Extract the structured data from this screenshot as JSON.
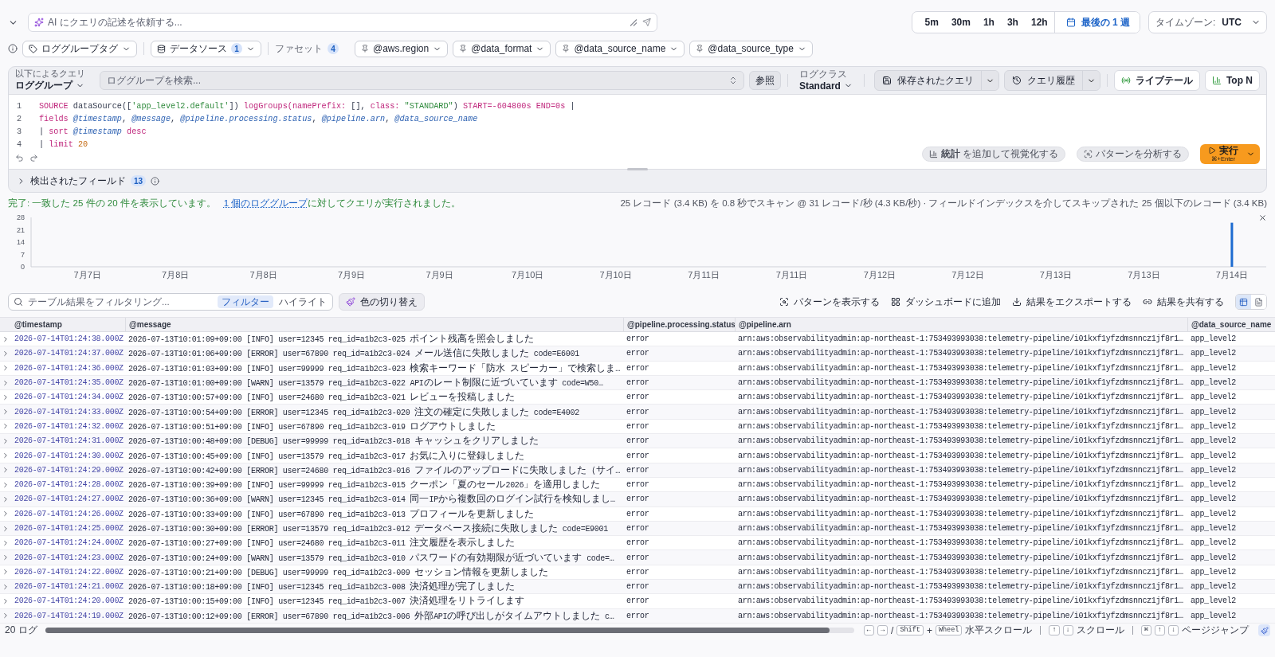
{
  "ai_prompt": {
    "placeholder": "AI にクエリの記述を依頼する..."
  },
  "time_ranges": [
    {
      "label": "5m",
      "selected": false
    },
    {
      "label": "30m",
      "selected": false
    },
    {
      "label": "1h",
      "selected": false
    },
    {
      "label": "3h",
      "selected": false
    },
    {
      "label": "12h",
      "selected": false
    }
  ],
  "custom_range": {
    "label": "最後の 1 週",
    "selected": true
  },
  "timezone": {
    "label": "タイムゾーン:",
    "value": "UTC"
  },
  "filters": {
    "log_group_tags": "ロググループタグ",
    "data_source": {
      "label": "データソース",
      "count": "1"
    },
    "facets": {
      "label": "ファセット",
      "count": "4",
      "items": [
        "@aws.region",
        "@data_format",
        "@data_source_name",
        "@data_source_type"
      ]
    }
  },
  "query": {
    "query_by": {
      "label": "以下によるクエリ",
      "value": "ロググループ"
    },
    "search": {
      "placeholder": "ロググループを検索..."
    },
    "browse": "参照",
    "log_class": {
      "label": "ログクラス",
      "value": "Standard"
    },
    "saved_queries": "保存されたクエリ",
    "history": "クエリ履歴",
    "live_tail": "ライブテール",
    "top_n": "Top N",
    "editor": {
      "lines": [
        {
          "number": "1",
          "tokens": [
            {
              "kind": "keyword",
              "text": "SOURCE"
            },
            {
              "kind": "plain",
              "text": " dataSource(["
            },
            {
              "kind": "string",
              "text": "'app_level2.default'"
            },
            {
              "kind": "plain",
              "text": "]) "
            },
            {
              "kind": "keyword",
              "text": "logGroups(namePrefix:"
            },
            {
              "kind": "plain",
              "text": " [], "
            },
            {
              "kind": "keyword",
              "text": "class: "
            },
            {
              "kind": "string",
              "text": "\"STANDARD\""
            },
            {
              "kind": "plain",
              "text": ") "
            },
            {
              "kind": "keyword",
              "text": "START=-604800s END=0s"
            },
            {
              "kind": "plain",
              "text": " |"
            }
          ]
        },
        {
          "number": "2",
          "tokens": [
            {
              "kind": "keyword",
              "text": "fields "
            },
            {
              "kind": "field",
              "text": "@timestamp"
            },
            {
              "kind": "plain",
              "text": ", "
            },
            {
              "kind": "field",
              "text": "@message"
            },
            {
              "kind": "plain",
              "text": ", "
            },
            {
              "kind": "field",
              "text": "@pipeline.processing.status"
            },
            {
              "kind": "plain",
              "text": ", "
            },
            {
              "kind": "field",
              "text": "@pipeline.arn"
            },
            {
              "kind": "plain",
              "text": ", "
            },
            {
              "kind": "field",
              "text": "@data_source_name"
            }
          ]
        },
        {
          "number": "3",
          "tokens": [
            {
              "kind": "plain",
              "text": "| "
            },
            {
              "kind": "keyword",
              "text": "sort "
            },
            {
              "kind": "field",
              "text": "@timestamp"
            },
            {
              "kind": "keyword",
              "text": " desc"
            }
          ]
        },
        {
          "number": "4",
          "tokens": [
            {
              "kind": "plain",
              "text": "| "
            },
            {
              "kind": "keyword",
              "text": "limit "
            },
            {
              "kind": "number",
              "text": "20"
            }
          ]
        }
      ]
    },
    "actions": {
      "visualize": "**統計** を追加して視覚化する",
      "analyze": "パターンを分析する",
      "run": {
        "label": "実行",
        "shortcut": "⌘+Enter"
      }
    },
    "discovered_fields": {
      "label": "検出されたフィールド",
      "count": "13",
      "expanded": false
    }
  },
  "status": {
    "summary": "完了: 一致した 25 件の 20 件を表示しています。",
    "link": "1 個のロググループ",
    "rest": "に対してクエリが実行されました。",
    "stats": "25 レコード (3.4 KB) を 0.8 秒でスキャン @ 31 レコード/秒 (4.3 KB/秒) · フィールドインデックスを介してスキップされた 25 個以下のレコード (3.4 KB)"
  },
  "histogram": {
    "chart_data": {
      "type": "bar",
      "categories": [
        "7月7日",
        "7月8日",
        "7月8日",
        "7月9日",
        "7月9日",
        "7月10日",
        "7月10日",
        "7月11日",
        "7月11日",
        "7月12日",
        "7月12日",
        "7月13日",
        "7月13日",
        "7月14日"
      ],
      "values": [
        0,
        0,
        0,
        0,
        0,
        0,
        0,
        0,
        0,
        0,
        0,
        0,
        0,
        25
      ],
      "ylim": [
        0,
        28
      ],
      "yticks": [
        0,
        7,
        14,
        21,
        28
      ]
    }
  },
  "table_toolbar": {
    "filter": {
      "placeholder": "テーブル結果をフィルタリング...",
      "modes": [
        {
          "label": "フィルター",
          "selected": true
        },
        {
          "label": "ハイライト",
          "selected": false
        }
      ]
    },
    "color_toggle": "色の切り替え",
    "actions": [
      {
        "kind": "patterns",
        "label": "パターンを表示する"
      },
      {
        "kind": "dashboard",
        "label": "ダッシュボードに追加"
      },
      {
        "kind": "export",
        "label": "結果をエクスポートする"
      },
      {
        "kind": "share",
        "label": "結果を共有する"
      }
    ],
    "views": [
      {
        "kind": "table",
        "selected": true
      },
      {
        "kind": "text",
        "selected": false
      }
    ]
  },
  "table": {
    "columns": [
      "@timestamp",
      "@message",
      "@pipeline.processing.status",
      "@pipeline.arn",
      "@data_source_name"
    ],
    "rows": [
      {
        "expanded": false,
        "cells": [
          "2026-07-14T01:24:38.000Z",
          "2026-07-13T10:01:09+09:00 [INFO] user=12345 req_id=a1b2c3-025 ポイント残高を照会しました",
          "error",
          "arn:aws:observabilityadmin:ap-northeast-1:753493993038:telemetry-pipeline/i01kxf1yfzdmsnncz1jf8r1…",
          "app_level2"
        ]
      },
      {
        "expanded": false,
        "cells": [
          "2026-07-14T01:24:37.000Z",
          "2026-07-13T10:01:06+09:00 [ERROR] user=67890 req_id=a1b2c3-024 メール送信に失敗しました code=E6001",
          "error",
          "arn:aws:observabilityadmin:ap-northeast-1:753493993038:telemetry-pipeline/i01kxf1yfzdmsnncz1jf8r1…",
          "app_level2"
        ]
      },
      {
        "expanded": false,
        "cells": [
          "2026-07-14T01:24:36.000Z",
          "2026-07-13T10:01:03+09:00 [INFO] user=99999 req_id=a1b2c3-023 検索キーワード「防水 スピーカー」で検索しま…",
          "error",
          "arn:aws:observabilityadmin:ap-northeast-1:753493993038:telemetry-pipeline/i01kxf1yfzdmsnncz1jf8r1…",
          "app_level2"
        ]
      },
      {
        "expanded": false,
        "cells": [
          "2026-07-14T01:24:35.000Z",
          "2026-07-13T10:01:00+09:00 [WARN] user=13579 req_id=a1b2c3-022 APIのレート制限に近づいています code=W50…",
          "error",
          "arn:aws:observabilityadmin:ap-northeast-1:753493993038:telemetry-pipeline/i01kxf1yfzdmsnncz1jf8r1…",
          "app_level2"
        ]
      },
      {
        "expanded": false,
        "cells": [
          "2026-07-14T01:24:34.000Z",
          "2026-07-13T10:00:57+09:00 [INFO] user=24680 req_id=a1b2c3-021 レビューを投稿しました",
          "error",
          "arn:aws:observabilityadmin:ap-northeast-1:753493993038:telemetry-pipeline/i01kxf1yfzdmsnncz1jf8r1…",
          "app_level2"
        ]
      },
      {
        "expanded": false,
        "cells": [
          "2026-07-14T01:24:33.000Z",
          "2026-07-13T10:00:54+09:00 [ERROR] user=12345 req_id=a1b2c3-020 注文の確定に失敗しました code=E4002",
          "error",
          "arn:aws:observabilityadmin:ap-northeast-1:753493993038:telemetry-pipeline/i01kxf1yfzdmsnncz1jf8r1…",
          "app_level2"
        ]
      },
      {
        "expanded": false,
        "cells": [
          "2026-07-14T01:24:32.000Z",
          "2026-07-13T10:00:51+09:00 [INFO] user=67890 req_id=a1b2c3-019 ログアウトしました",
          "error",
          "arn:aws:observabilityadmin:ap-northeast-1:753493993038:telemetry-pipeline/i01kxf1yfzdmsnncz1jf8r1…",
          "app_level2"
        ]
      },
      {
        "expanded": false,
        "cells": [
          "2026-07-14T01:24:31.000Z",
          "2026-07-13T10:00:48+09:00 [DEBUG] user=99999 req_id=a1b2c3-018 キャッシュをクリアしました",
          "error",
          "arn:aws:observabilityadmin:ap-northeast-1:753493993038:telemetry-pipeline/i01kxf1yfzdmsnncz1jf8r1…",
          "app_level2"
        ]
      },
      {
        "expanded": false,
        "cells": [
          "2026-07-14T01:24:30.000Z",
          "2026-07-13T10:00:45+09:00 [INFO] user=13579 req_id=a1b2c3-017 お気に入りに登録しました",
          "error",
          "arn:aws:observabilityadmin:ap-northeast-1:753493993038:telemetry-pipeline/i01kxf1yfzdmsnncz1jf8r1…",
          "app_level2"
        ]
      },
      {
        "expanded": false,
        "cells": [
          "2026-07-14T01:24:29.000Z",
          "2026-07-13T10:00:42+09:00 [ERROR] user=24680 req_id=a1b2c3-016 ファイルのアップロードに失敗しました（サイ…",
          "error",
          "arn:aws:observabilityadmin:ap-northeast-1:753493993038:telemetry-pipeline/i01kxf1yfzdmsnncz1jf8r1…",
          "app_level2"
        ]
      },
      {
        "expanded": false,
        "cells": [
          "2026-07-14T01:24:28.000Z",
          "2026-07-13T10:00:39+09:00 [INFO] user=99999 req_id=a1b2c3-015 クーポン「夏のセール2026」を適用しました",
          "error",
          "arn:aws:observabilityadmin:ap-northeast-1:753493993038:telemetry-pipeline/i01kxf1yfzdmsnncz1jf8r1…",
          "app_level2"
        ]
      },
      {
        "expanded": false,
        "cells": [
          "2026-07-14T01:24:27.000Z",
          "2026-07-13T10:00:36+09:00 [WARN] user=12345 req_id=a1b2c3-014 同一IPから複数回のログイン試行を検知しまし…",
          "error",
          "arn:aws:observabilityadmin:ap-northeast-1:753493993038:telemetry-pipeline/i01kxf1yfzdmsnncz1jf8r1…",
          "app_level2"
        ]
      },
      {
        "expanded": false,
        "cells": [
          "2026-07-14T01:24:26.000Z",
          "2026-07-13T10:00:33+09:00 [INFO] user=67890 req_id=a1b2c3-013 プロフィールを更新しました",
          "error",
          "arn:aws:observabilityadmin:ap-northeast-1:753493993038:telemetry-pipeline/i01kxf1yfzdmsnncz1jf8r1…",
          "app_level2"
        ]
      },
      {
        "expanded": false,
        "cells": [
          "2026-07-14T01:24:25.000Z",
          "2026-07-13T10:00:30+09:00 [ERROR] user=13579 req_id=a1b2c3-012 データベース接続に失敗しました code=E9001",
          "error",
          "arn:aws:observabilityadmin:ap-northeast-1:753493993038:telemetry-pipeline/i01kxf1yfzdmsnncz1jf8r1…",
          "app_level2"
        ]
      },
      {
        "expanded": false,
        "cells": [
          "2026-07-14T01:24:24.000Z",
          "2026-07-13T10:00:27+09:00 [INFO] user=24680 req_id=a1b2c3-011 注文履歴を表示しました",
          "error",
          "arn:aws:observabilityadmin:ap-northeast-1:753493993038:telemetry-pipeline/i01kxf1yfzdmsnncz1jf8r1…",
          "app_level2"
        ]
      },
      {
        "expanded": false,
        "cells": [
          "2026-07-14T01:24:23.000Z",
          "2026-07-13T10:00:24+09:00 [WARN] user=13579 req_id=a1b2c3-010 パスワードの有効期限が近づいています code=…",
          "error",
          "arn:aws:observabilityadmin:ap-northeast-1:753493993038:telemetry-pipeline/i01kxf1yfzdmsnncz1jf8r1…",
          "app_level2"
        ]
      },
      {
        "expanded": false,
        "cells": [
          "2026-07-14T01:24:22.000Z",
          "2026-07-13T10:00:21+09:00 [DEBUG] user=99999 req_id=a1b2c3-009 セッション情報を更新しました",
          "error",
          "arn:aws:observabilityadmin:ap-northeast-1:753493993038:telemetry-pipeline/i01kxf1yfzdmsnncz1jf8r1…",
          "app_level2"
        ]
      },
      {
        "expanded": false,
        "cells": [
          "2026-07-14T01:24:21.000Z",
          "2026-07-13T10:00:18+09:00 [INFO] user=12345 req_id=a1b2c3-008 決済処理が完了しました",
          "error",
          "arn:aws:observabilityadmin:ap-northeast-1:753493993038:telemetry-pipeline/i01kxf1yfzdmsnncz1jf8r1…",
          "app_level2"
        ]
      },
      {
        "expanded": false,
        "cells": [
          "2026-07-14T01:24:20.000Z",
          "2026-07-13T10:00:15+09:00 [INFO] user=12345 req_id=a1b2c3-007 決済処理をリトライします",
          "error",
          "arn:aws:observabilityadmin:ap-northeast-1:753493993038:telemetry-pipeline/i01kxf1yfzdmsnncz1jf8r1…",
          "app_level2"
        ]
      },
      {
        "expanded": false,
        "cells": [
          "2026-07-14T01:24:19.000Z",
          "2026-07-13T10:00:12+09:00 [ERROR] user=67890 req_id=a1b2c3-006 外部APIの呼び出しがタイムアウトしました c…",
          "error",
          "arn:aws:observabilityadmin:ap-northeast-1:753493993038:telemetry-pipeline/i01kxf1yfzdmsnncz1jf8r1…",
          "app_level2"
        ]
      }
    ]
  },
  "footer": {
    "count": "20 ログ",
    "hints": [
      {
        "keys": [
          {
            "kind": "key",
            "text": "←"
          },
          {
            "kind": "key",
            "text": "→"
          },
          {
            "kind": "plain",
            "text": "/"
          },
          {
            "kind": "key",
            "text": "Shift"
          },
          {
            "kind": "plain",
            "text": "+"
          },
          {
            "kind": "key",
            "text": "Wheel"
          }
        ],
        "label": "水平スクロール"
      },
      {
        "keys": [
          {
            "kind": "key",
            "text": "↑"
          },
          {
            "kind": "key",
            "text": "↓"
          }
        ],
        "label": "スクロール"
      },
      {
        "keys": [
          {
            "kind": "key",
            "text": "⌘"
          },
          {
            "kind": "key",
            "text": "↑"
          },
          {
            "kind": "key",
            "text": "↓"
          }
        ],
        "label": "ページジャンプ"
      }
    ]
  }
}
